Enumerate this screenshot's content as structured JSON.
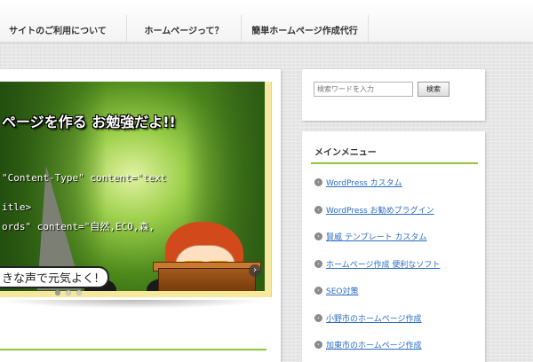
{
  "nav": {
    "items": [
      {
        "label": "サイトのご利用について"
      },
      {
        "label": "ホームページって？"
      },
      {
        "label": "簡単ホームページ作成代行"
      }
    ]
  },
  "slider": {
    "heading": "ページを作る お勉強だよ!!",
    "code_lines": [
      "\"Content-Type\" content=\"text",
      "itle>",
      "ords\" content=\"自然,ECO,森,"
    ],
    "bubble": "きな声で元気よく!",
    "arrow": "›",
    "dots": 3,
    "active_dot": 0
  },
  "search": {
    "placeholder": "検索ワードを入力",
    "button_label": "検索"
  },
  "menu": {
    "title": "メインメニュー",
    "bullet": "›",
    "items": [
      {
        "label": "WordPress カスタム"
      },
      {
        "label": "WordPress お勧めプラグイン"
      },
      {
        "label": "賢威 テンプレート カスタム"
      },
      {
        "label": "ホームページ作成 便利なソフト"
      },
      {
        "label": "SEO対策"
      },
      {
        "label": "小野市のホームページ作成"
      },
      {
        "label": "加東市のホームページ作成"
      }
    ]
  },
  "colors": {
    "accent_green": "#8ec63f",
    "link_blue": "#2b6cc4",
    "slider_frame": "#f6e89c"
  }
}
